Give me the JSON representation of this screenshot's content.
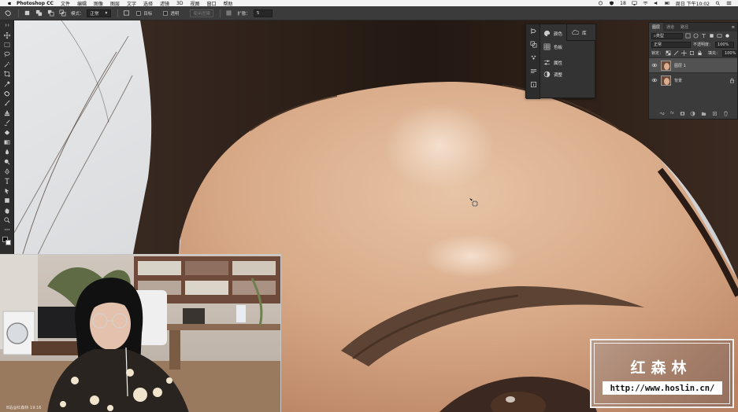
{
  "menubar": {
    "app_name": "Photoshop CC",
    "menus": [
      "文件",
      "编辑",
      "图像",
      "图层",
      "文字",
      "选择",
      "滤镜",
      "3D",
      "视图",
      "窗口",
      "帮助"
    ],
    "battery_text": "18",
    "clock": "周日 下午10:02"
  },
  "options_bar": {
    "mode_label": "模式：",
    "mode_value": "正常",
    "target_label": "目标",
    "transparent_label": "透明",
    "use_pattern_label": "使用图案",
    "spread_label": "扩散：",
    "spread_value": "5"
  },
  "mini_panel": {
    "items": [
      {
        "label": "颜色",
        "icon": "palette-icon"
      },
      {
        "label": "色板",
        "icon": "grid-icon"
      },
      {
        "label": "属性",
        "icon": "sliders-icon"
      },
      {
        "label": "调整",
        "icon": "contrast-icon"
      }
    ],
    "extra_item": {
      "label": "库",
      "icon": "cloud-icon"
    }
  },
  "layers_panel": {
    "tabs": [
      "图层",
      "通道",
      "路径"
    ],
    "filter_label": "类型",
    "blend_mode": "正常",
    "opacity_label": "不透明度：",
    "opacity_value": "100%",
    "lock_label": "锁定：",
    "fill_label": "填充：",
    "fill_value": "100%",
    "layers": [
      {
        "name": "图层 1",
        "selected": true,
        "locked": false
      },
      {
        "name": "背景",
        "selected": false,
        "locked": true
      }
    ]
  },
  "webcam": {
    "caption": "B站@红森林 19:16"
  },
  "watermark": {
    "title": "红森林",
    "url": "http://www.hoslin.cn/"
  },
  "colors": {
    "ui_dark": "#2d2d2d",
    "ui_panel": "#3b3b3b",
    "skin": "#d9ad8d",
    "hair": "#2e2018"
  }
}
